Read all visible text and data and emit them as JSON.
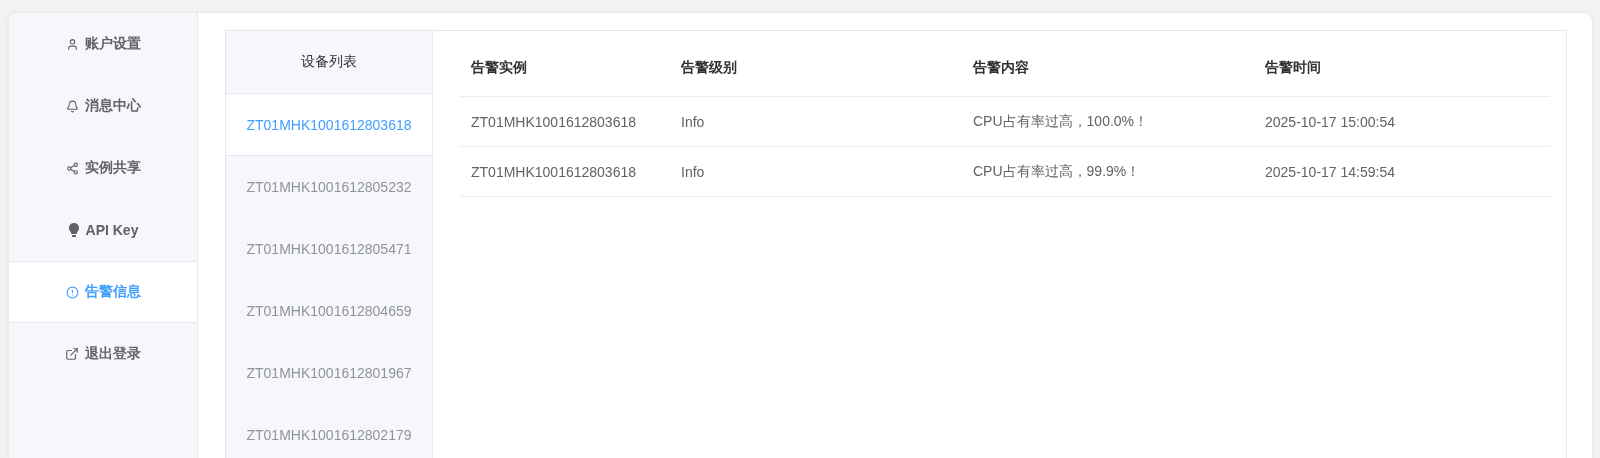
{
  "sidebar": {
    "items": [
      {
        "label": "账户设置",
        "selected": false
      },
      {
        "label": "消息中心",
        "selected": false
      },
      {
        "label": "实例共享",
        "selected": false
      },
      {
        "label": "API Key",
        "selected": false
      },
      {
        "label": "告警信息",
        "selected": true
      },
      {
        "label": "退出登录",
        "selected": false
      }
    ]
  },
  "device_list": {
    "title": "设备列表",
    "items": [
      {
        "label": "ZT01MHK1001612803618",
        "selected": true
      },
      {
        "label": "ZT01MHK1001612805232",
        "selected": false
      },
      {
        "label": "ZT01MHK1001612805471",
        "selected": false
      },
      {
        "label": "ZT01MHK1001612804659",
        "selected": false
      },
      {
        "label": "ZT01MHK1001612801967",
        "selected": false
      },
      {
        "label": "ZT01MHK1001612802179",
        "selected": false
      }
    ]
  },
  "table": {
    "columns": [
      "告警实例",
      "告警级别",
      "告警内容",
      "告警时间"
    ],
    "rows": [
      [
        "ZT01MHK1001612803618",
        "Info",
        "CPU占有率过高，100.0%！",
        "2025-10-17 15:00:54"
      ],
      [
        "ZT01MHK1001612803618",
        "Info",
        "CPU占有率过高，99.9%！",
        "2025-10-17 14:59:54"
      ]
    ]
  }
}
